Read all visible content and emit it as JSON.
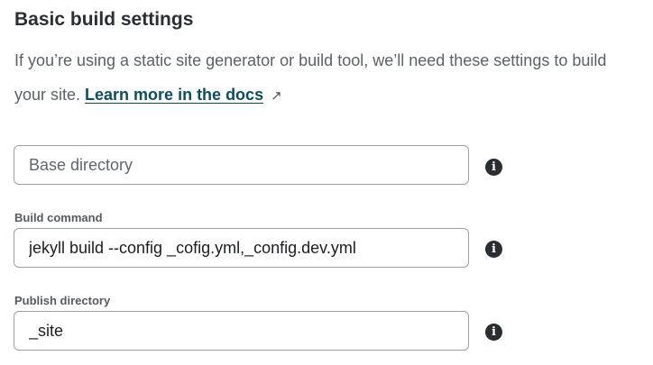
{
  "section": {
    "title": "Basic build settings",
    "description_line1": "If you’re using a static site generator or build tool, we’ll need these settings to build",
    "description_line2_prefix": "your site. ",
    "docs_link_label": "Learn more in the docs",
    "docs_link_icon": "external-arrow-icon",
    "docs_link_glyph": "↗"
  },
  "fields": {
    "base_directory": {
      "label": "",
      "value": "",
      "placeholder": "Base directory"
    },
    "build_command": {
      "label": "Build command",
      "value": "jekyll build --config _cofig.yml,_config.dev.yml",
      "placeholder": ""
    },
    "publish_directory": {
      "label": "Publish directory",
      "value": "_site",
      "placeholder": ""
    }
  },
  "icons": {
    "info_glyph": "i"
  }
}
